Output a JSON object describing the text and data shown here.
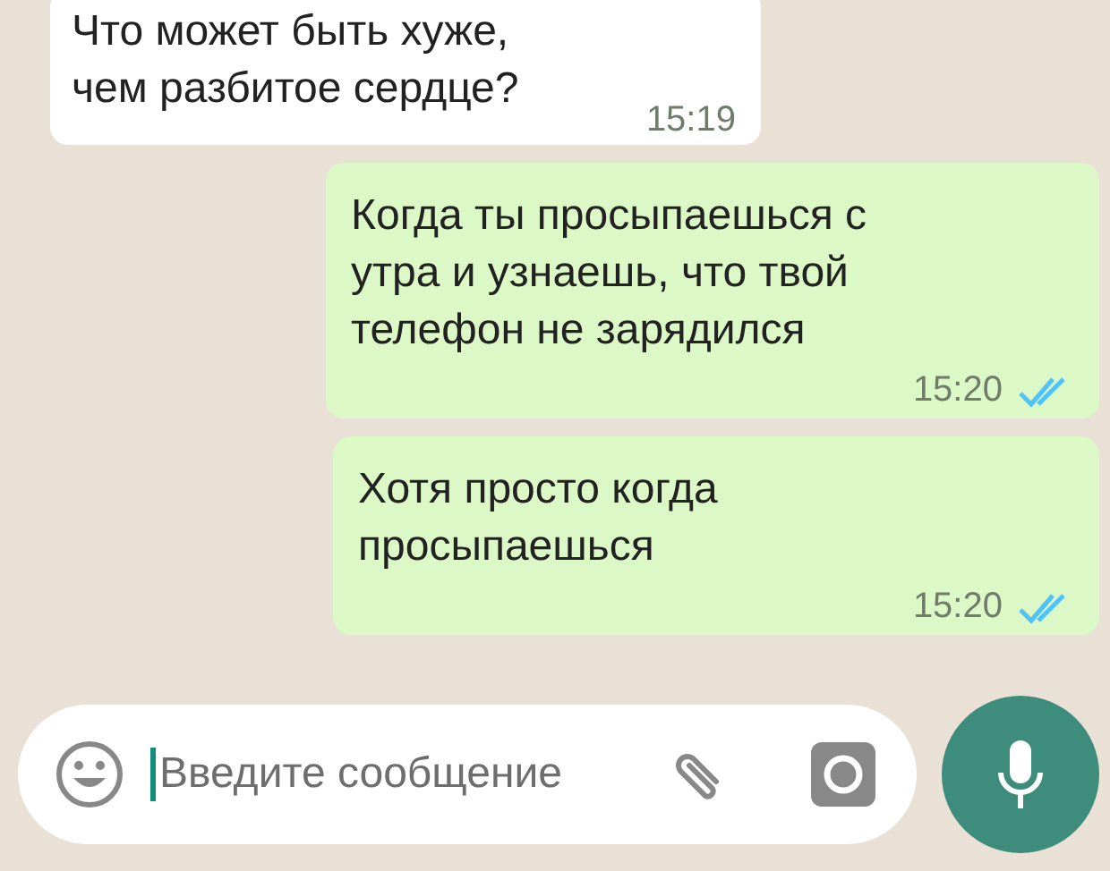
{
  "messages": [
    {
      "kind": "incoming",
      "text": "Что может быть хуже,\nчем разбитое сердце?",
      "time": "15:19"
    },
    {
      "kind": "outgoing",
      "text": "Когда ты просыпаешься с\nутра и узнаешь, что твой\nтелефон не зарядился",
      "time": "15:20",
      "read": true
    },
    {
      "kind": "outgoing",
      "text": "Хотя просто когда\nпросыпаешься",
      "time": "15:20",
      "read": true
    }
  ],
  "composer": {
    "placeholder": "Введите сообщение"
  }
}
